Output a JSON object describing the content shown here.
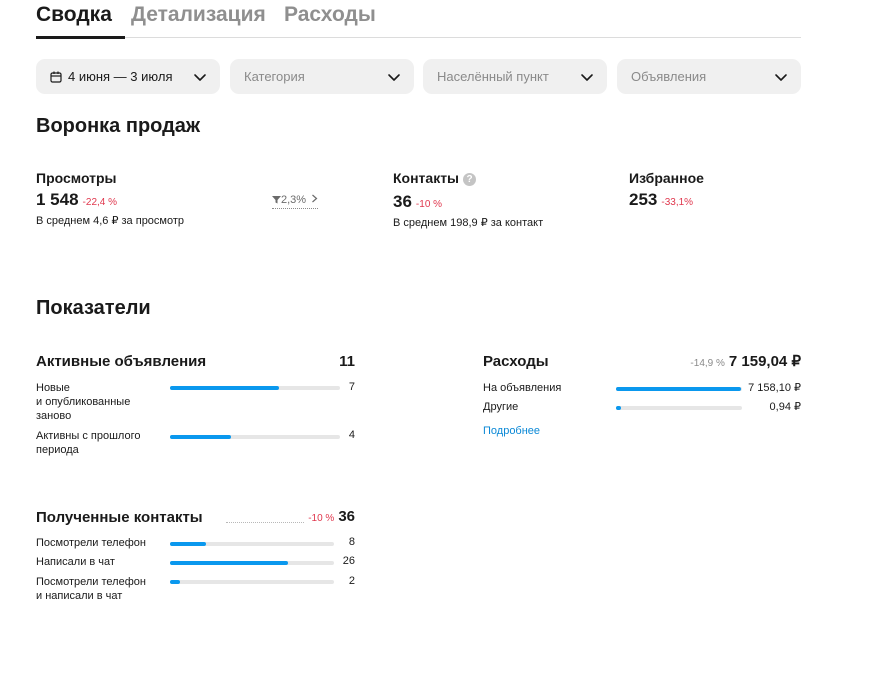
{
  "tabs": [
    {
      "label": "Сводка",
      "active": true
    },
    {
      "label": "Детализация",
      "active": false
    },
    {
      "label": "Расходы",
      "active": false
    }
  ],
  "filters": {
    "date": "4 июня — 3 июля",
    "category_placeholder": "Категория",
    "location_placeholder": "Населённый пункт",
    "ads_placeholder": "Объявления"
  },
  "funnel": {
    "title": "Воронка продаж",
    "views": {
      "label": "Просмотры",
      "value": "1 548",
      "delta": "-22,4 %",
      "sub": "В среднем 4,6 ₽ за просмотр"
    },
    "conversion": "2,3%",
    "contacts": {
      "label": "Контакты",
      "value": "36",
      "delta": "-10 %",
      "sub": "В среднем 198,9 ₽ за контакт",
      "help": "?"
    },
    "favorites": {
      "label": "Избранное",
      "value": "253",
      "delta": "-33,1%"
    }
  },
  "indicators": {
    "title": "Показатели",
    "active_ads": {
      "title": "Активные объявления",
      "total": "11",
      "rows": [
        {
          "label": "Новые\nи опубликованные\nзаново",
          "value": "7",
          "fraction": 0.64
        },
        {
          "label": "Активны с прошлого\nпериода",
          "value": "4",
          "fraction": 0.36
        }
      ]
    },
    "expenses": {
      "title": "Расходы",
      "delta": "-14,9 %",
      "total": "7 159,04 ₽",
      "rows": [
        {
          "label": "На объявления",
          "value": "7 158,10 ₽",
          "fraction": 0.99
        },
        {
          "label": "Другие",
          "value": "0,94 ₽",
          "fraction": 0.04
        }
      ],
      "link": "Подробнее"
    },
    "contacts": {
      "title": "Полученные контакты",
      "delta": "-10 %",
      "total": "36",
      "rows": [
        {
          "label": "Посмотрели телефон",
          "value": "8",
          "fraction": 0.22
        },
        {
          "label": "Написали в чат",
          "value": "26",
          "fraction": 0.72
        },
        {
          "label": "Посмотрели телефон\nи написали в чат",
          "value": "2",
          "fraction": 0.06
        }
      ]
    }
  },
  "colors": {
    "accent": "#0a98ee",
    "negative": "#e0384e",
    "link": "#0a88d6"
  },
  "icons": {
    "date": "calendar-icon",
    "dropdown": "chevron-down-icon",
    "conversion": "funnel-icon",
    "help": "question-icon"
  }
}
